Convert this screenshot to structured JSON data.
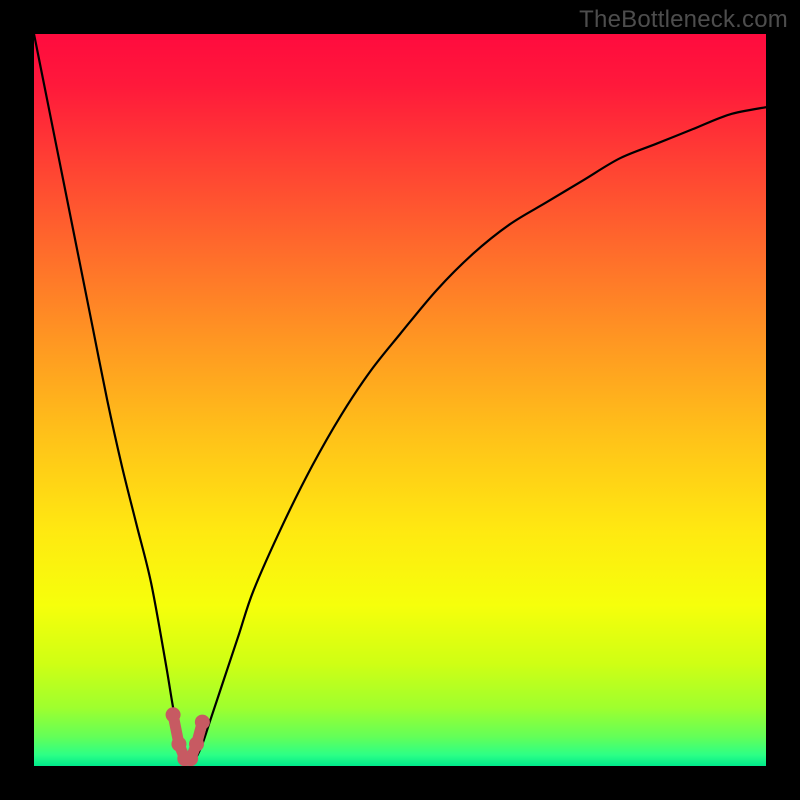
{
  "watermark": "TheBottleneck.com",
  "colors": {
    "black": "#000000",
    "watermark": "#4d4d4d",
    "curve": "#000000",
    "marker": "#c75a62"
  },
  "chart_data": {
    "type": "line",
    "title": "",
    "xlabel": "",
    "ylabel": "",
    "xlim": [
      0,
      100
    ],
    "ylim": [
      0,
      100
    ],
    "series": [
      {
        "name": "bottleneck-curve",
        "x": [
          0,
          2,
          4,
          6,
          8,
          10,
          12,
          14,
          16,
          18,
          19,
          20,
          21,
          22,
          23,
          24,
          26,
          28,
          30,
          34,
          38,
          42,
          46,
          50,
          55,
          60,
          65,
          70,
          75,
          80,
          85,
          90,
          95,
          100
        ],
        "y": [
          100,
          90,
          80,
          70,
          60,
          50,
          41,
          33,
          25,
          14,
          8,
          3,
          1,
          1,
          3,
          6,
          12,
          18,
          24,
          33,
          41,
          48,
          54,
          59,
          65,
          70,
          74,
          77,
          80,
          83,
          85,
          87,
          89,
          90
        ]
      }
    ],
    "markers": {
      "x": [
        19.0,
        19.8,
        20.6,
        21.4,
        22.2,
        23.0
      ],
      "y": [
        7,
        3,
        1,
        1,
        3,
        6
      ]
    },
    "gradient_stops": [
      {
        "pos": 0.0,
        "color": "#ff0b3e"
      },
      {
        "pos": 0.07,
        "color": "#ff193b"
      },
      {
        "pos": 0.18,
        "color": "#ff4233"
      },
      {
        "pos": 0.3,
        "color": "#ff6d2b"
      },
      {
        "pos": 0.42,
        "color": "#ff9722"
      },
      {
        "pos": 0.55,
        "color": "#ffc219"
      },
      {
        "pos": 0.68,
        "color": "#ffe911"
      },
      {
        "pos": 0.78,
        "color": "#f6ff0b"
      },
      {
        "pos": 0.86,
        "color": "#cfff14"
      },
      {
        "pos": 0.92,
        "color": "#9fff2e"
      },
      {
        "pos": 0.96,
        "color": "#63ff58"
      },
      {
        "pos": 0.985,
        "color": "#2cff86"
      },
      {
        "pos": 1.0,
        "color": "#00e98a"
      }
    ]
  }
}
